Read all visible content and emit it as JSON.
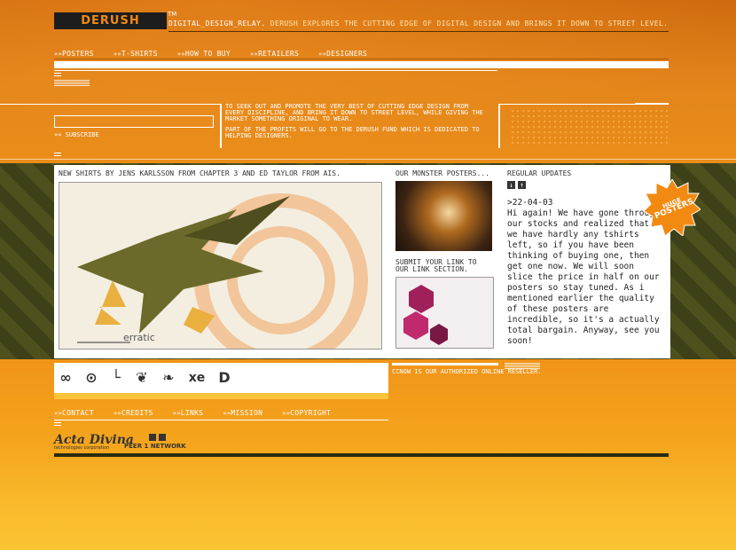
{
  "header": {
    "logo_text": "DERUSH",
    "tm": "TM",
    "relay": "DIGITAL_DESIGN_RELAY.",
    "tagline": "DERUSH EXPLORES THE CUTTING EDGE OF DIGITAL DESIGN AND BRINGS IT DOWN TO STREET LEVEL."
  },
  "nav": [
    "POSTERS",
    "T-SHIRTS",
    "HOW TO BUY",
    "RETAILERS",
    "DESIGNERS"
  ],
  "subscribe": {
    "label": "SUBSCRIBE",
    "value": ""
  },
  "mission": {
    "p1": "TO SEEK OUT AND PROMOTE THE VERY BEST OF CUTTING EDGE DESIGN FROM EVERY DISCIPLINE, AND BRING IT DOWN TO STREET LEVEL, WHILE GIVING THE MARKET SOMETHING ORIGINAL TO WEAR.",
    "p2": "PART OF THE PROFITS WILL GO TO THE DERUSH FUND WHICH IS DEDICATED TO HELPING DESIGNERS."
  },
  "feature": {
    "title": "NEW SHIRTS BY JENS KARLSSON FROM CHAPTER 3 AND ED TAYLOR FROM AIS.",
    "art_label": "erratic"
  },
  "posters": {
    "title": "OUR MONSTER POSTERS...",
    "submit_title": "SUBMIT YOUR LINK TO OUR LINK SECTION."
  },
  "updates": {
    "title": "REGULAR UPDATES",
    "date": ">22-04-03",
    "body": "Hi again! We have gone through our stocks and realized that we have hardly any tshirts left, so if you have been thinking of buying one, then get one now. We will soon slice the price in half on our posters so stay tuned. As i mentioned earlier the quality of these posters are incredible, so it's a actually total bargain. Anyway, see you soon!"
  },
  "badge": {
    "line1": "HUGE",
    "line2": "POSTERS"
  },
  "icons": [
    "link-icon",
    "target-icon",
    "hook-icon",
    "creature-icon",
    "leaf-icon",
    "xe-icon",
    "d-icon"
  ],
  "reseller": "CCNOW IS OUR AUTHORIZED ONLINE RESELLER.",
  "footer_nav": [
    "CONTACT",
    "CREDITS",
    "LINKS",
    "MISSION",
    "COPYRIGHT"
  ],
  "sponsors": {
    "acta": "Acta Divina",
    "acta_sub": "technologies corporation",
    "peer": "PEER 1 NETWORK"
  },
  "colors": {
    "orange": "#e8891a",
    "olive": "#44461a",
    "dark": "#1d1d1d"
  }
}
